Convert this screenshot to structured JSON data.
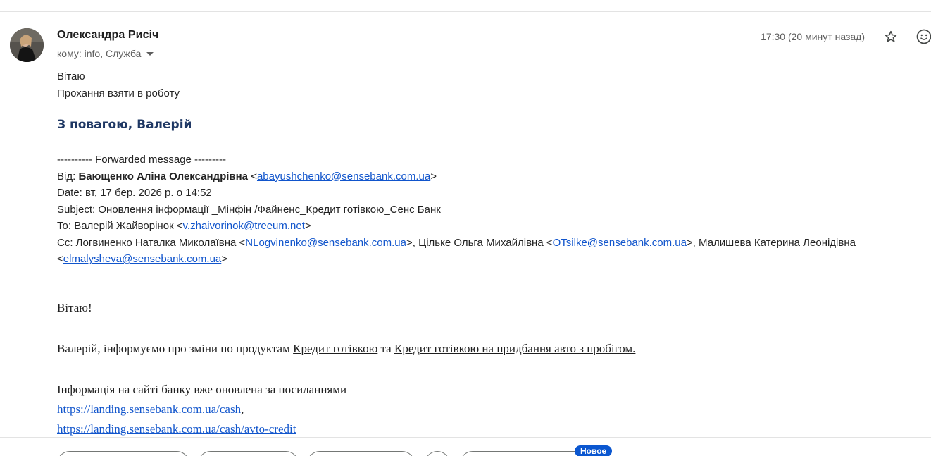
{
  "message": {
    "sender_name": "Олександра Рисіч",
    "recipients_label": "кому: info, Служба",
    "timestamp": "17:30 (20 минут назад)",
    "body": {
      "greeting": "Вітаю",
      "request": "Прохання взяти в роботу"
    },
    "signature": "З повагою, Валерій"
  },
  "forwarded": {
    "separator": "---------- Forwarded message ---------",
    "from": {
      "label": "Від:",
      "name": "Бающенко Аліна Олександрівна",
      "email": "abayushchenko@sensebank.com.ua"
    },
    "date": {
      "label": "Date:",
      "value": "вт, 17 бер. 2026 р. о 14:52"
    },
    "subject": {
      "label": "Subject:",
      "value": "Оновлення інформації _Мінфін /Файненс_Кредит готівкою_Сенс Банк"
    },
    "to": {
      "label": "To:",
      "name": "Валерій Жайворінок",
      "email": "v.zhaivorinok@treeum.net"
    },
    "cc": {
      "label": "Cc:",
      "people": [
        {
          "name": "Логвиненко Наталка Миколаївна",
          "email": "NLogvinenko@sensebank.com.ua"
        },
        {
          "name": "Цільке Ольга Михайлівна",
          "email": "OTsilke@sensebank.com.ua"
        },
        {
          "name": "Малишева Катерина Леонідівна",
          "email": "elmalysheva@sensebank.com.ua"
        }
      ]
    }
  },
  "forwarded_body": {
    "greeting": "Вітаю!",
    "line1_prefix": "Валерій, інформуємо про зміни по продуктам ",
    "product1": "Кредит готівкою",
    "conjunction": " та ",
    "product2": "Кредит готівкою на придбання авто з пробігом.",
    "info_line": "Інформація на сайті банку вже оновлена за посиланнями",
    "link1": "https://landing.sensebank.com.ua/cash",
    "link1_suffix": ",",
    "link2": "https://landing.sensebank.com.ua/cash/avto-credit"
  },
  "actions": {
    "new_badge": "Новое"
  },
  "icons": {
    "star": "star-outline-icon",
    "emoji": "add-reaction-icon",
    "caret": "chevron-down-icon"
  },
  "colors": {
    "link": "#1155cc",
    "signature": "#1f3864",
    "badge": "#0b57d0"
  }
}
